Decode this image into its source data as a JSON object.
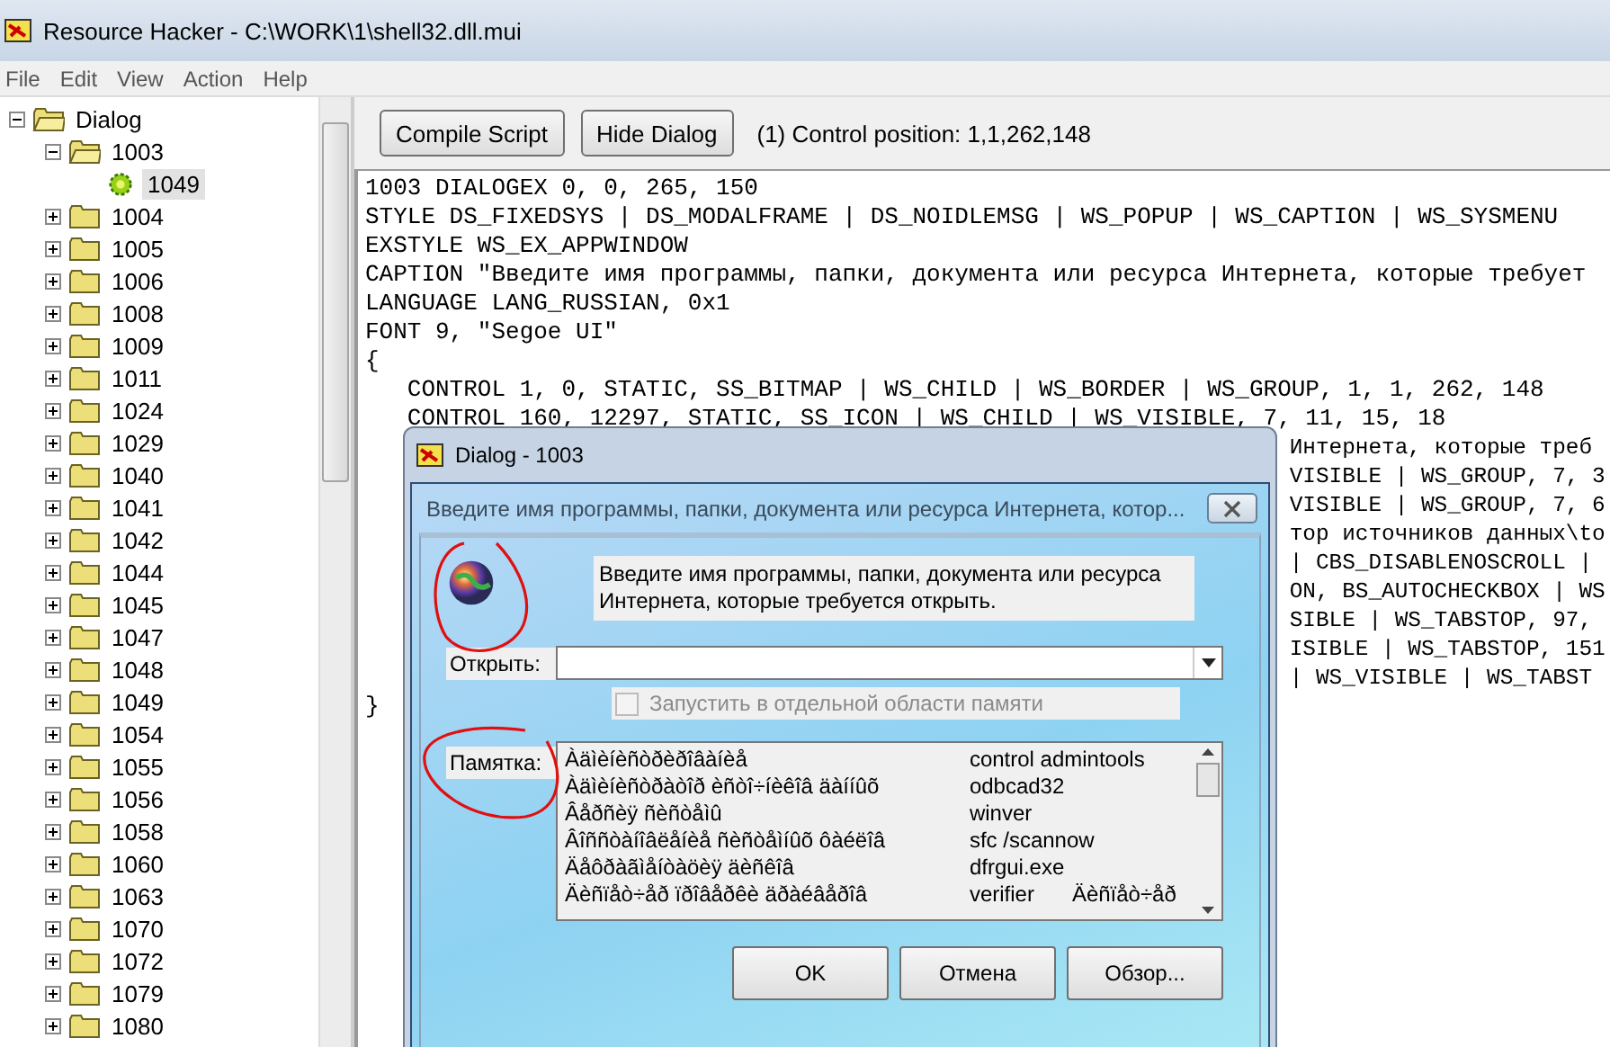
{
  "window": {
    "title": "Resource Hacker  -  C:\\WORK\\1\\shell32.dll.mui"
  },
  "menu": [
    "File",
    "Edit",
    "View",
    "Action",
    "Help"
  ],
  "tree": [
    {
      "label": "Dialog",
      "expanded": true,
      "selected": false,
      "kind": "folder",
      "children": [
        {
          "label": "1003",
          "expanded": true,
          "selected": false,
          "kind": "folder",
          "children": [
            {
              "label": "1049",
              "selected": true,
              "kind": "resource"
            }
          ]
        },
        {
          "label": "1004",
          "expanded": false,
          "selected": false,
          "kind": "folder"
        },
        {
          "label": "1005",
          "expanded": false,
          "selected": false,
          "kind": "folder"
        },
        {
          "label": "1006",
          "expanded": false,
          "selected": false,
          "kind": "folder"
        },
        {
          "label": "1008",
          "expanded": false,
          "selected": false,
          "kind": "folder"
        },
        {
          "label": "1009",
          "expanded": false,
          "selected": false,
          "kind": "folder"
        },
        {
          "label": "1011",
          "expanded": false,
          "selected": false,
          "kind": "folder"
        },
        {
          "label": "1024",
          "expanded": false,
          "selected": false,
          "kind": "folder"
        },
        {
          "label": "1029",
          "expanded": false,
          "selected": false,
          "kind": "folder"
        },
        {
          "label": "1040",
          "expanded": false,
          "selected": false,
          "kind": "folder"
        },
        {
          "label": "1041",
          "expanded": false,
          "selected": false,
          "kind": "folder"
        },
        {
          "label": "1042",
          "expanded": false,
          "selected": false,
          "kind": "folder"
        },
        {
          "label": "1044",
          "expanded": false,
          "selected": false,
          "kind": "folder"
        },
        {
          "label": "1045",
          "expanded": false,
          "selected": false,
          "kind": "folder"
        },
        {
          "label": "1047",
          "expanded": false,
          "selected": false,
          "kind": "folder"
        },
        {
          "label": "1048",
          "expanded": false,
          "selected": false,
          "kind": "folder"
        },
        {
          "label": "1049",
          "expanded": false,
          "selected": false,
          "kind": "folder"
        },
        {
          "label": "1054",
          "expanded": false,
          "selected": false,
          "kind": "folder"
        },
        {
          "label": "1055",
          "expanded": false,
          "selected": false,
          "kind": "folder"
        },
        {
          "label": "1056",
          "expanded": false,
          "selected": false,
          "kind": "folder"
        },
        {
          "label": "1058",
          "expanded": false,
          "selected": false,
          "kind": "folder"
        },
        {
          "label": "1060",
          "expanded": false,
          "selected": false,
          "kind": "folder"
        },
        {
          "label": "1063",
          "expanded": false,
          "selected": false,
          "kind": "folder"
        },
        {
          "label": "1070",
          "expanded": false,
          "selected": false,
          "kind": "folder"
        },
        {
          "label": "1072",
          "expanded": false,
          "selected": false,
          "kind": "folder"
        },
        {
          "label": "1079",
          "expanded": false,
          "selected": false,
          "kind": "folder"
        },
        {
          "label": "1080",
          "expanded": false,
          "selected": false,
          "kind": "folder"
        }
      ]
    }
  ],
  "toolbar": {
    "buttons": [
      "Compile Script",
      "Hide Dialog"
    ],
    "status": "(1)  Control position: 1,1,262,148"
  },
  "code": [
    {
      "text": "1003 DIALOGEX 0, 0, 265, 150"
    },
    {
      "text": "STYLE DS_FIXEDSYS | DS_MODALFRAME | DS_NOIDLEMSG | WS_POPUP | WS_CAPTION | WS_SYSMENU"
    },
    {
      "text": "EXSTYLE WS_EX_APPWINDOW"
    },
    {
      "text": "CAPTION \"Введите имя программы, папки, документа или ресурса Интернета, которые требует"
    },
    {
      "text": "LANGUAGE LANG_RUSSIAN, 0x1"
    },
    {
      "text": "FONT 9, \"Segoe UI\""
    },
    {
      "text": "{"
    },
    {
      "text": "   CONTROL 1, 0, STATIC, SS_BITMAP | WS_CHILD | WS_BORDER | WS_GROUP, 1, 1, 262, 148"
    },
    {
      "text": "   CONTROL 160, 12297, STATIC, SS_ICON | WS_CHILD | WS_VISIBLE, 7, 11, 15, 18"
    },
    {
      "tail": "Интернета, которые треб"
    },
    {
      "tail": "VISIBLE | WS_GROUP, 7, 3"
    },
    {
      "tail": "VISIBLE | WS_GROUP, 7, 6"
    },
    {
      "tail": "тор источников данных\\to"
    },
    {
      "tail": "| CBS_DISABLENOSCROLL |"
    },
    {
      "tail": "ON, BS_AUTOCHECKBOX | WS"
    },
    {
      "tail": "SIBLE | WS_TABSTOP, 97,"
    },
    {
      "tail": "ISIBLE | WS_TABSTOP, 151"
    },
    {
      "tail": "| WS_VISIBLE | WS_TABST"
    },
    {
      "text": "}"
    }
  ],
  "preview": {
    "frame_title": "Dialog -  1003",
    "caption": "Введите имя программы, папки, документа или ресурса Интернета, котор...",
    "prompt": "Введите имя программы, папки, документа или ресурса Интернета, которые требуется открыть.",
    "open_label": "Открыть:",
    "checkbox": {
      "label": "Запустить в отдельной области памяти",
      "checked": false,
      "disabled": true
    },
    "memo_label": "Памятка:",
    "memo_rows": [
      [
        "Àäìèíèñòðèðîâàíèå",
        "control admintools"
      ],
      [
        "Àäìèíèñòðàòîð èñòî÷íèêîâ äàííûõ",
        "odbcad32"
      ],
      [
        "Âåðñèÿ ñèñòåìû",
        "winver"
      ],
      [
        "Âîññòàíîâëåíèå ñèñòåìíûõ ôàéëîâ",
        "sfc /scannow"
      ],
      [
        "Äåôðàãìåíòàöèÿ äèñêîâ",
        "dfrgui.exe"
      ],
      [
        "Äèñïåò÷åð ïðîâåðêè äðàéâåðîâ",
        "verifier",
        "Äèñïåò÷åð"
      ]
    ],
    "buttons": [
      "OK",
      "Отмена",
      "Обзор..."
    ]
  }
}
